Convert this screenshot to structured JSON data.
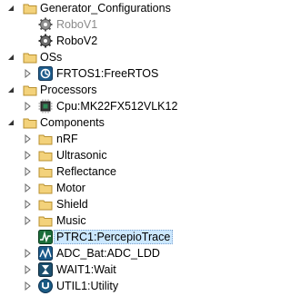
{
  "tree": {
    "generator_configurations": {
      "label": "Generator_Configurations",
      "children": [
        "RoboV1",
        "RoboV2"
      ]
    },
    "oss": {
      "label": "OSs",
      "children": [
        "FRTOS1:FreeRTOS"
      ]
    },
    "processors": {
      "label": "Processors",
      "children": [
        "Cpu:MK22FX512VLK12"
      ]
    },
    "components": {
      "label": "Components",
      "folders": [
        "nRF",
        "Ultrasonic",
        "Reflectance",
        "Motor",
        "Shield",
        "Music"
      ],
      "items": [
        "PTRC1:PercepioTrace",
        "ADC_Bat:ADC_LDD",
        "WAIT1:Wait",
        "UTIL1:Utility"
      ]
    }
  },
  "icons": {
    "expanded_arrow": "triangle-down-icon",
    "collapsed_arrow": "triangle-right-icon",
    "folder": "folder-icon",
    "configuration": "gear-icon",
    "os": "os-component-icon",
    "processor": "cpu-chip-icon",
    "trace": "trace-component-icon",
    "adc": "adc-component-icon",
    "wait": "wait-component-icon",
    "utility": "utility-component-icon"
  },
  "colors": {
    "selection": "#cce8ff",
    "selection_border": "#7da2ce",
    "folder": "#e8c36a",
    "disabled_text": "#8a8a8a"
  }
}
